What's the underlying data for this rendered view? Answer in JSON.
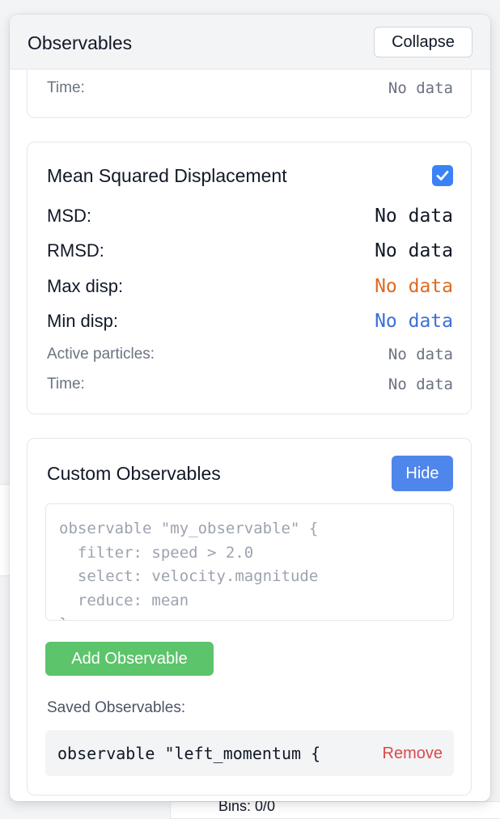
{
  "panel": {
    "title": "Observables",
    "collapse_label": "Collapse"
  },
  "prev_card": {
    "time_label": "Time:",
    "time_value": "No data"
  },
  "msd_card": {
    "title": "Mean Squared Displacement",
    "enabled": true,
    "rows": [
      {
        "label": "MSD:",
        "value": "No data"
      },
      {
        "label": "RMSD:",
        "value": "No data"
      },
      {
        "label": "Max disp:",
        "value": "No data"
      },
      {
        "label": "Min disp:",
        "value": "No data"
      },
      {
        "label": "Active particles:",
        "value": "No data"
      },
      {
        "label": "Time:",
        "value": "No data"
      }
    ]
  },
  "custom_card": {
    "title": "Custom Observables",
    "hide_label": "Hide",
    "editor_placeholder": "observable \"my_observable\" {\n  filter: speed > 2.0\n  select: velocity.magnitude\n  reduce: mean\n}",
    "add_label": "Add Observable",
    "saved_label": "Saved Observables:",
    "saved_items": [
      {
        "code": "observable \"left_momentum {",
        "remove_label": "Remove"
      }
    ]
  },
  "background": {
    "bins_text": "Bins: 0/0"
  },
  "colors": {
    "accent": "#3b82f6",
    "add_button": "#5cc46b",
    "max_value": "#dd6b20",
    "min_value": "#3b6fd8",
    "remove": "#d84a4a"
  }
}
